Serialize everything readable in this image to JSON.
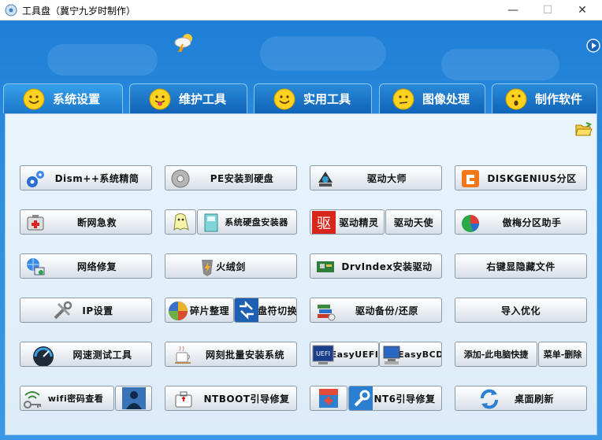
{
  "window": {
    "title": "工具盘（冀宁九岁时制作）",
    "min_glyph": "—",
    "max_glyph": "☐",
    "close_glyph": "✕"
  },
  "tabs": [
    {
      "label": "系统设置",
      "icon": "smiley-face-icon",
      "active": true
    },
    {
      "label": "维护工具",
      "icon": "tongue-face-icon",
      "active": false
    },
    {
      "label": "实用工具",
      "icon": "smiley-face-icon",
      "active": false
    },
    {
      "label": "图像处理",
      "icon": "neutral-face-icon",
      "active": false
    },
    {
      "label": "制作软件",
      "icon": "surprised-face-icon",
      "active": false
    }
  ],
  "buttons": {
    "dism": "Dism++系统精简",
    "pe_install": "PE安装到硬盘",
    "driver_master": "驱动大师",
    "diskgenius": "DISKGENIUS分区",
    "net_rescue": "断网急救",
    "sys_disk_installer": "系统硬盘安装器",
    "driver_elf": "驱动精灵",
    "driver_angel": "驱动天使",
    "aomei_partition": "傲梅分区助手",
    "net_repair": "网络修复",
    "fire_sword": "火绒剑",
    "drvindex": "DrvIndex安装驱动",
    "toggle_hidden": "右键显隐藏文件",
    "ip_settings": "IP设置",
    "defrag": "碎片整理",
    "drive_letter": "盘符切换",
    "driver_backup": "驱动备份/还原",
    "import_optimize": "导入优化",
    "speed_test": "网速测试工具",
    "batch_install": "网刻批量安装系统",
    "easyuefi": "EasyUEFI",
    "easybcd": "EasyBCD",
    "add_pc_shortcut": "添加-此电脑快捷",
    "menu_delete": "菜单-删除",
    "wifi_password": "wifi密码查看",
    "ntboot": "NTBOOT引导修复",
    "nt6": "NT6引导修复",
    "desktop_refresh": "桌面刷新"
  }
}
